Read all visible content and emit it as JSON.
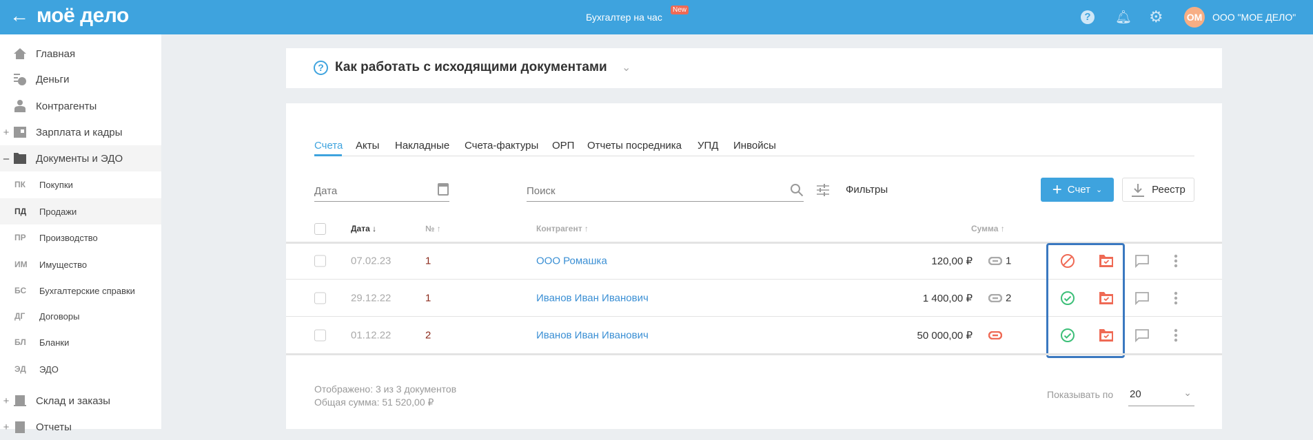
{
  "header": {
    "brand": "моё дело",
    "center_link": "Бухгалтер на час",
    "badge": "New",
    "avatar_initials": "ОМ",
    "company": "ООО \"МОЕ ДЕЛО\""
  },
  "sidebar": {
    "items": [
      {
        "label": "Главная",
        "icon": "home-icon",
        "pm": ""
      },
      {
        "label": "Деньги",
        "icon": "money-icon",
        "pm": ""
      },
      {
        "label": "Контрагенты",
        "icon": "person-icon",
        "pm": ""
      },
      {
        "label": "Зарплата и кадры",
        "icon": "wallet-icon",
        "pm": "+"
      },
      {
        "label": "Документы и ЭДО",
        "icon": "folder-icon",
        "pm": "–"
      }
    ],
    "subitems": [
      {
        "abbr": "ПК",
        "label": "Покупки"
      },
      {
        "abbr": "ПД",
        "label": "Продажи"
      },
      {
        "abbr": "ПР",
        "label": "Производство"
      },
      {
        "abbr": "ИМ",
        "label": "Имущество"
      },
      {
        "abbr": "БС",
        "label": "Бухгалтерские справки"
      },
      {
        "abbr": "ДГ",
        "label": "Договоры"
      },
      {
        "abbr": "БЛ",
        "label": "Бланки"
      },
      {
        "abbr": "ЭД",
        "label": "ЭДО"
      }
    ],
    "bottom_items": [
      {
        "label": "Склад и заказы",
        "pm": "+"
      },
      {
        "label": "Отчеты",
        "pm": "+"
      }
    ]
  },
  "help": {
    "title": "Как работать с исходящими документами"
  },
  "tabs": [
    "Счета",
    "Акты",
    "Накладные",
    "Счета-фактуры",
    "ОРП",
    "Отчеты посредника",
    "УПД",
    "Инвойсы"
  ],
  "filters": {
    "date_placeholder": "Дата",
    "search_placeholder": "Поиск",
    "filters_label": "Фильтры",
    "create_label": "Счет",
    "registry_label": "Реестр"
  },
  "table": {
    "headers": {
      "date": "Дата ↓",
      "num": "№ ↑",
      "contractor": "Контрагент ↑",
      "sum": "Сумма ↑"
    },
    "rows": [
      {
        "date": "07.02.23",
        "num": "1",
        "contractor": "ООО Ромашка",
        "sum": "120,00 ₽",
        "links": "1",
        "link_status": "linked",
        "status": "cancelled"
      },
      {
        "date": "29.12.22",
        "num": "1",
        "contractor": "Иванов Иван Иванович",
        "sum": "1 400,00 ₽",
        "links": "2",
        "link_status": "linked",
        "status": "paid"
      },
      {
        "date": "01.12.22",
        "num": "2",
        "contractor": "Иванов Иван Иванович",
        "sum": "50 000,00 ₽",
        "links": "",
        "link_status": "unlinked",
        "status": "paid"
      }
    ]
  },
  "footer": {
    "shown": "Отображено: 3 из 3 документов",
    "total": "Общая сумма: 51 520,00 ₽",
    "page_size_label": "Показывать по",
    "page_size": "20"
  },
  "colors": {
    "brand": "#3ea3de",
    "red": "#ef6a55",
    "green": "#3cbf78",
    "highlight": "#3a78c0"
  }
}
